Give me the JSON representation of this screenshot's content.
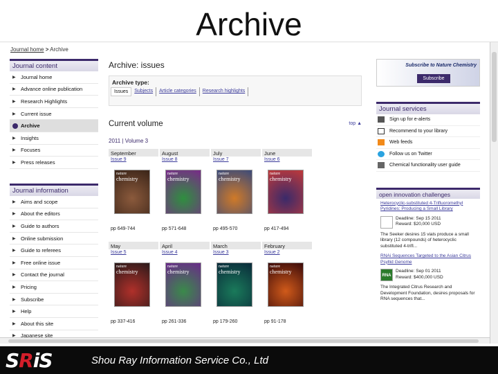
{
  "slide": {
    "title": "Archive"
  },
  "breadcrumb": {
    "home": "Journal home",
    "sep": ">",
    "current": "Archive"
  },
  "journal_content": {
    "heading": "Journal content",
    "items": [
      {
        "label": "Journal home"
      },
      {
        "label": "Advance online publication"
      },
      {
        "label": "Research Highlights"
      },
      {
        "label": "Current issue"
      },
      {
        "label": "Archive"
      },
      {
        "label": "Insights"
      },
      {
        "label": "Focuses"
      },
      {
        "label": "Press releases"
      }
    ]
  },
  "journal_information": {
    "heading": "Journal information",
    "items": [
      {
        "label": "Aims and scope"
      },
      {
        "label": "About the editors"
      },
      {
        "label": "Guide to authors"
      },
      {
        "label": "Online submission"
      },
      {
        "label": "Guide to referees"
      },
      {
        "label": "Free online issue"
      },
      {
        "label": "Contact the journal"
      },
      {
        "label": "Pricing"
      },
      {
        "label": "Subscribe"
      },
      {
        "label": "Help"
      },
      {
        "label": "About this site"
      },
      {
        "label": "Japanese site"
      }
    ]
  },
  "main": {
    "heading": "Archive: issues",
    "archive_type_label": "Archive type:",
    "archive_tabs": [
      "Issues",
      "Subjects",
      "Article categories",
      "Research highlights"
    ],
    "current_volume": "Current volume",
    "top_link": "top",
    "volume": "2011 | Volume 3",
    "issues": [
      {
        "month": "September",
        "issue": "Issue 9",
        "pages": "pp 649-744",
        "c1": "#8b5a3c",
        "c2": "#3a2418"
      },
      {
        "month": "August",
        "issue": "Issue 8",
        "pages": "pp 571-648",
        "c1": "#2f8f3f",
        "c2": "#7a2a8a"
      },
      {
        "month": "July",
        "issue": "Issue 7",
        "pages": "pp 495-570",
        "c1": "#d07a28",
        "c2": "#3a4a7a"
      },
      {
        "month": "June",
        "issue": "Issue 6",
        "pages": "pp 417-494",
        "c1": "#3a2a6a",
        "c2": "#c03a3a"
      },
      {
        "month": "May",
        "issue": "Issue 5",
        "pages": "pp 337-416",
        "c1": "#b0302a",
        "c2": "#2a1a1a"
      },
      {
        "month": "April",
        "issue": "Issue 4",
        "pages": "pp 261-336",
        "c1": "#3a8a4a",
        "c2": "#6a2a8a"
      },
      {
        "month": "March",
        "issue": "Issue 3",
        "pages": "pp 179-260",
        "c1": "#1a7a5a",
        "c2": "#0a2a3a"
      },
      {
        "month": "February",
        "issue": "Issue 2",
        "pages": "pp 91-178",
        "c1": "#d05a1a",
        "c2": "#3a0a0a"
      }
    ],
    "cover_masthead": [
      "nature",
      "chemistry"
    ]
  },
  "subscribe": {
    "title": "Subscribe to Nature Chemistry",
    "button": "Subscribe"
  },
  "journal_services": {
    "heading": "Journal services",
    "items": [
      {
        "label": "Sign up for e-alerts",
        "icon": "email-icon",
        "color": "#555555"
      },
      {
        "label": "Recommend to your library",
        "icon": "checkbox-icon",
        "color": "#333333"
      },
      {
        "label": "Web feeds",
        "icon": "rss-icon",
        "color": "#f28a1a"
      },
      {
        "label": "Follow us on Twitter",
        "icon": "twitter-icon",
        "color": "#2aa3e0"
      },
      {
        "label": "Chemical functionality user guide",
        "icon": "guide-icon",
        "color": "#666666"
      }
    ]
  },
  "open_innovation": {
    "heading": "open innovation challenges",
    "challenges": [
      {
        "title": "Heterocyclic-substituted 4-Trifluoromethyl Pyridines: Producing a Small Library",
        "deadline": "Deadline: Sep 15 2011",
        "reward": "Reward: $20,000 USD",
        "summary": "The Seeker desires 15 vials produce a small library (12 compounds) of heterocyclic substituted 4-trifl...",
        "logo": ""
      },
      {
        "title": "RNAi Sequences Targeted to the Asian Citrus Psyllid Genome",
        "deadline": "Deadline: Sep 01 2011",
        "reward": "Reward: $400,000 USD",
        "summary": "The Integrated Citrus Research and Development Foundation, desires proposals for RNA sequences that...",
        "logo": "RNA"
      }
    ]
  },
  "footer": {
    "logo": "SRiS",
    "company": "Shou Ray Information Service Co., Ltd"
  }
}
